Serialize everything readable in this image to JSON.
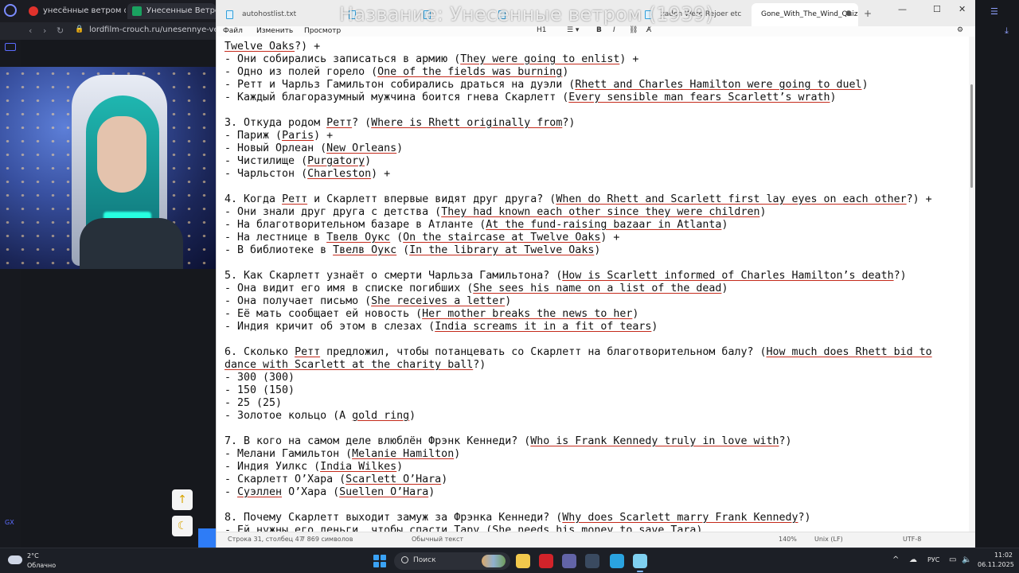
{
  "stream_overlay": {
    "title": "Название: Унесенные ветром (1939)"
  },
  "browser": {
    "tabs": [
      {
        "label": "унесённые ветром филь",
        "favicon_color": "#e0322c",
        "active": false
      },
      {
        "label": "Унесенные Ветром Фи",
        "favicon_color": "#1aa260",
        "active": true
      }
    ],
    "url": "lordfilm-crouch.ru/unesennye-vetrom-",
    "float_up_icon": "↑",
    "float_moon_icon": "☾"
  },
  "notepad": {
    "tabs": [
      {
        "label": "autohostlist.txt",
        "active": false
      },
      {
        "label": "",
        "active": false
      },
      {
        "label": "",
        "active": false
      },
      {
        "label": "",
        "active": false
      },
      {
        "label": "zadon Were Rejoer etc",
        "active": false
      },
      {
        "label": "Gone_With_The_Wind_Quiz",
        "active": true
      }
    ],
    "new_tab": "+",
    "window_controls": {
      "minimize": "—",
      "maximize": "☐",
      "close": "✕"
    },
    "menu": {
      "file": "Файл",
      "edit": "Изменить",
      "view": "Просмотр"
    },
    "toolbar": {
      "heading": "H1",
      "list_icon": "list-icon",
      "bold": "B",
      "italic": "I",
      "link_icon": "link-icon",
      "clear_icon": "clear-format-icon",
      "settings_icon": "gear-icon"
    },
    "lines": [
      [
        {
          "t": "Twelve Oaks",
          "u": true
        },
        {
          "t": "?) +"
        }
      ],
      [
        {
          "t": "- Они собирались записаться в армию ("
        },
        {
          "t": "They were going to enlist",
          "u": true
        },
        {
          "t": ") +"
        }
      ],
      [
        {
          "t": "- Одно из полей горело ("
        },
        {
          "t": "One of the fields was burning",
          "u": true
        },
        {
          "t": ")"
        }
      ],
      [
        {
          "t": "- Ретт и Чарльз Гамильтон собирались драться на дуэли ("
        },
        {
          "t": "Rhett and Charles Hamilton were going to duel",
          "u": true
        },
        {
          "t": ")"
        }
      ],
      [
        {
          "t": "- Каждый благоразумный мужчина боится гнева Скарлетт ("
        },
        {
          "t": "Every sensible man fears Scarlett’s wrath",
          "u": true
        },
        {
          "t": ")"
        }
      ],
      [
        {
          "t": ""
        }
      ],
      [
        {
          "t": "3. Откуда родом "
        },
        {
          "t": "Ретт",
          "u": true
        },
        {
          "t": "? ("
        },
        {
          "t": "Where is Rhett originally from",
          "u": true
        },
        {
          "t": "?)"
        }
      ],
      [
        {
          "t": "- Париж ("
        },
        {
          "t": "Paris",
          "u": true
        },
        {
          "t": ") +"
        }
      ],
      [
        {
          "t": "- Новый Орлеан ("
        },
        {
          "t": "New Orleans",
          "u": true
        },
        {
          "t": ")"
        }
      ],
      [
        {
          "t": "- Чистилище ("
        },
        {
          "t": "Purgatory",
          "u": true
        },
        {
          "t": ")"
        }
      ],
      [
        {
          "t": "- Чарльстон ("
        },
        {
          "t": "Charleston",
          "u": true
        },
        {
          "t": ") +"
        }
      ],
      [
        {
          "t": ""
        }
      ],
      [
        {
          "t": "4. Когда "
        },
        {
          "t": "Ретт",
          "u": true
        },
        {
          "t": " и Скарлетт впервые видят друг друга? ("
        },
        {
          "t": "When do Rhett and Scarlett first lay eyes on each other",
          "u": true
        },
        {
          "t": "?) +"
        }
      ],
      [
        {
          "t": "- Они знали друг друга с детства ("
        },
        {
          "t": "They had known each other since they were children",
          "u": true
        },
        {
          "t": ")"
        }
      ],
      [
        {
          "t": "- На благотворительном базаре в Атланте ("
        },
        {
          "t": "At the fund-raising bazaar in Atlanta",
          "u": true
        },
        {
          "t": ")"
        }
      ],
      [
        {
          "t": "- На лестнице в "
        },
        {
          "t": "Твелв Оукс",
          "u": true
        },
        {
          "t": " ("
        },
        {
          "t": "On the staircase at Twelve Oaks",
          "u": true
        },
        {
          "t": ") +"
        }
      ],
      [
        {
          "t": "- В библиотеке в "
        },
        {
          "t": "Твелв Оукс",
          "u": true
        },
        {
          "t": " ("
        },
        {
          "t": "In the library at Twelve Oaks",
          "u": true
        },
        {
          "t": ")"
        }
      ],
      [
        {
          "t": ""
        }
      ],
      [
        {
          "t": "5. Как Скарлетт узнаёт о смерти Чарльза Гамильтона? ("
        },
        {
          "t": "How is Scarlett informed of Charles Hamilton’s death",
          "u": true
        },
        {
          "t": "?)"
        }
      ],
      [
        {
          "t": "- Она видит его имя в списке погибших ("
        },
        {
          "t": "She sees his name on a list of the dead",
          "u": true
        },
        {
          "t": ")"
        }
      ],
      [
        {
          "t": "- Она получает письмо ("
        },
        {
          "t": "She receives a letter",
          "u": true
        },
        {
          "t": ")"
        }
      ],
      [
        {
          "t": "- Её мать сообщает ей новость ("
        },
        {
          "t": "Her mother breaks the news to her",
          "u": true
        },
        {
          "t": ")"
        }
      ],
      [
        {
          "t": "- Индия кричит об этом в слезах ("
        },
        {
          "t": "India screams it in a fit of tears",
          "u": true
        },
        {
          "t": ")"
        }
      ],
      [
        {
          "t": ""
        }
      ],
      [
        {
          "t": "6. Сколько "
        },
        {
          "t": "Ретт",
          "u": true
        },
        {
          "t": " предложил, чтобы потанцевать со Скарлетт на благотворительном балу? ("
        },
        {
          "t": "How much does Rhett bid to",
          "u": true
        }
      ],
      [
        {
          "t": "dance with Scarlett at the charity ball",
          "u": true
        },
        {
          "t": "?)"
        }
      ],
      [
        {
          "t": "- 300 (300)"
        }
      ],
      [
        {
          "t": "- 150 (150)"
        }
      ],
      [
        {
          "t": "- 25 (25)"
        }
      ],
      [
        {
          "t": "- Золотое кольцо (A "
        },
        {
          "t": "gold ring",
          "u": true
        },
        {
          "t": ")"
        }
      ],
      [
        {
          "t": ""
        }
      ],
      [
        {
          "t": "7. В кого на самом деле влюблён Фрэнк Кеннеди? ("
        },
        {
          "t": "Who is Frank Kennedy truly in love with",
          "u": true
        },
        {
          "t": "?)"
        }
      ],
      [
        {
          "t": "- Мелани Гамильтон ("
        },
        {
          "t": "Melanie Hamilton",
          "u": true
        },
        {
          "t": ")"
        }
      ],
      [
        {
          "t": "- Индия Уилкс ("
        },
        {
          "t": "India Wilkes",
          "u": true
        },
        {
          "t": ")"
        }
      ],
      [
        {
          "t": "- Скарлетт О’Хара ("
        },
        {
          "t": "Scarlett O’Hara",
          "u": true
        },
        {
          "t": ")"
        }
      ],
      [
        {
          "t": "- "
        },
        {
          "t": "Суэллен",
          "u": true
        },
        {
          "t": " О’Хара ("
        },
        {
          "t": "Suellen O’Hara",
          "u": true
        },
        {
          "t": ")"
        }
      ],
      [
        {
          "t": ""
        }
      ],
      [
        {
          "t": "8. Почему Скарлетт выходит замуж за Фрэнка Кеннеди? ("
        },
        {
          "t": "Why does Scarlett marry Frank Kennedy",
          "u": true
        },
        {
          "t": "?)"
        }
      ],
      [
        {
          "t": "- Ей нужны его деньги, чтобы спасти Тару ("
        },
        {
          "t": "She needs his money to save Tara",
          "u": true
        },
        {
          "t": ")"
        }
      ]
    ],
    "status": {
      "position": "Строка 31, столбец 47",
      "chars": "7 869 символов",
      "format": "Обычный текст",
      "zoom": "140%",
      "eol": "Unix (LF)",
      "encoding": "UTF-8"
    }
  },
  "taskbar": {
    "weather": {
      "temp": "2°C",
      "condition": "Облачно"
    },
    "search_label": "Поиск",
    "apps": [
      {
        "name": "file-explorer",
        "color": "#f2c94c"
      },
      {
        "name": "opera",
        "color": "#d2232a"
      },
      {
        "name": "teams",
        "color": "#6264a7"
      },
      {
        "name": "steam",
        "color": "#3a4a60"
      },
      {
        "name": "telegram",
        "color": "#2aa3e0"
      },
      {
        "name": "notepad",
        "color": "#7fd0f0"
      }
    ],
    "tray": {
      "chevron": "^",
      "lang": "РУС"
    },
    "clock": {
      "time": "11:02",
      "date": "06.11.2025"
    }
  }
}
